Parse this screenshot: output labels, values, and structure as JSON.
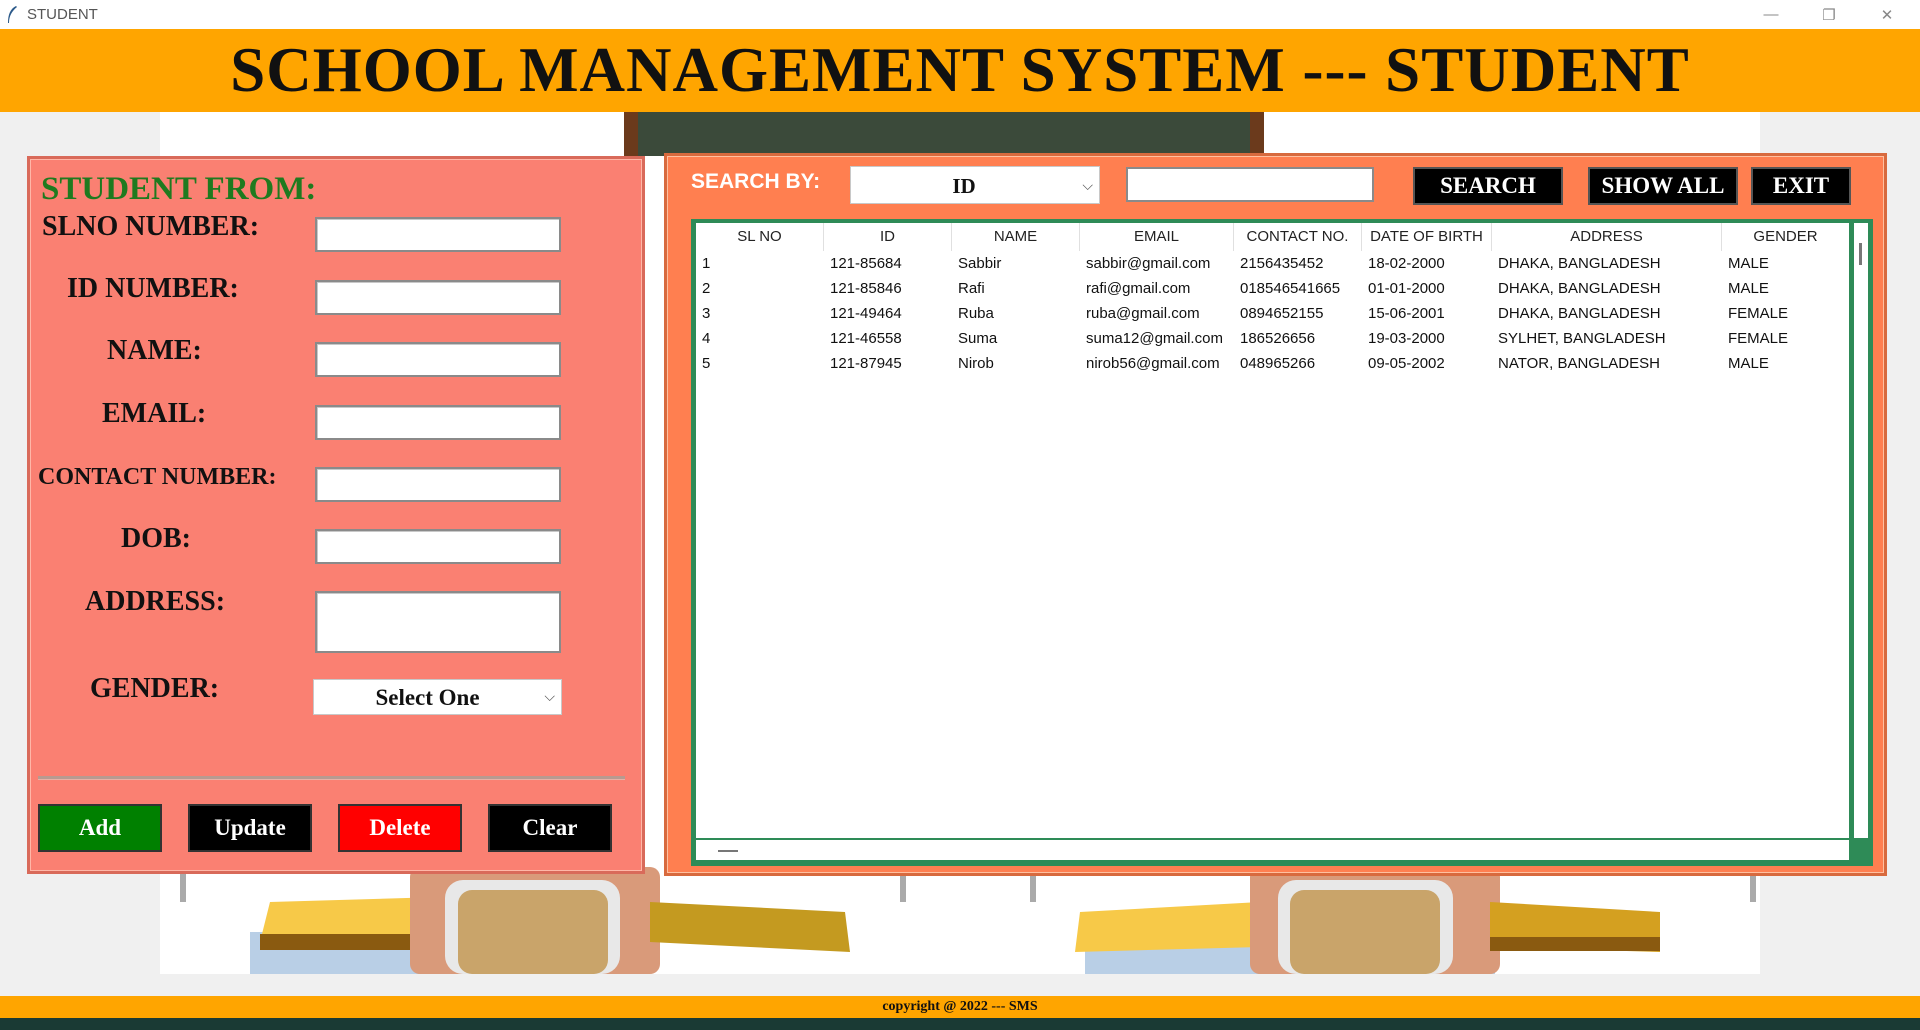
{
  "window": {
    "title": "STUDENT",
    "controls": {
      "minimize": "—",
      "restore": "❐",
      "close": "✕"
    }
  },
  "header": {
    "title": "SCHOOL MANAGEMENT SYSTEM --- STUDENT"
  },
  "form": {
    "title": "STUDENT FROM:",
    "labels": {
      "slno": "SLNO NUMBER:",
      "id": "ID NUMBER:",
      "name": "NAME:",
      "email": "EMAIL:",
      "contact": "CONTACT NUMBER:",
      "dob": "DOB:",
      "address": "ADDRESS:",
      "gender": "GENDER:"
    },
    "values": {
      "slno": "",
      "id": "",
      "name": "",
      "email": "",
      "contact": "",
      "dob": "",
      "address": ""
    },
    "gender_selected": "Select One",
    "buttons": {
      "add": "Add",
      "update": "Update",
      "delete": "Delete",
      "clear": "Clear"
    }
  },
  "search": {
    "label": "SEARCH BY:",
    "field_selected": "ID",
    "query": "",
    "buttons": {
      "search": "SEARCH",
      "show_all": "SHOW ALL",
      "exit": "EXIT"
    }
  },
  "table": {
    "columns": [
      "SL NO",
      "ID",
      "NAME",
      "EMAIL",
      "CONTACT NO.",
      "DATE OF BIRTH",
      "ADDRESS",
      "GENDER"
    ],
    "rows": [
      [
        "1",
        "121-85684",
        "Sabbir",
        "sabbir@gmail.com",
        "2156435452",
        "18-02-2000",
        "DHAKA, BANGLADESH",
        "MALE"
      ],
      [
        "2",
        "121-85846",
        "Rafi",
        "rafi@gmail.com",
        "018546541665",
        "01-01-2000",
        "DHAKA, BANGLADESH",
        "MALE"
      ],
      [
        "3",
        "121-49464",
        "Ruba",
        "ruba@gmail.com",
        "0894652155",
        "15-06-2001",
        "DHAKA, BANGLADESH",
        "FEMALE"
      ],
      [
        "4",
        "121-46558",
        "Suma",
        "suma12@gmail.com",
        "186526656",
        "19-03-2000",
        "SYLHET, BANGLADESH",
        "FEMALE"
      ],
      [
        "5",
        "121-87945",
        "Nirob",
        "nirob56@gmail.com",
        "048965266",
        "09-05-2002",
        "NATOR, BANGLADESH",
        "MALE"
      ]
    ]
  },
  "footer": {
    "text": "copyright @ 2022 --- SMS"
  },
  "colors": {
    "banner": "#ffa500",
    "form_panel": "#fa8072",
    "table_panel": "#ff7f50",
    "table_border": "#2e8b57",
    "form_title": "#1f7a1f",
    "add_button": "#008000",
    "delete_button": "#ff0000",
    "dark_button": "#000000"
  }
}
